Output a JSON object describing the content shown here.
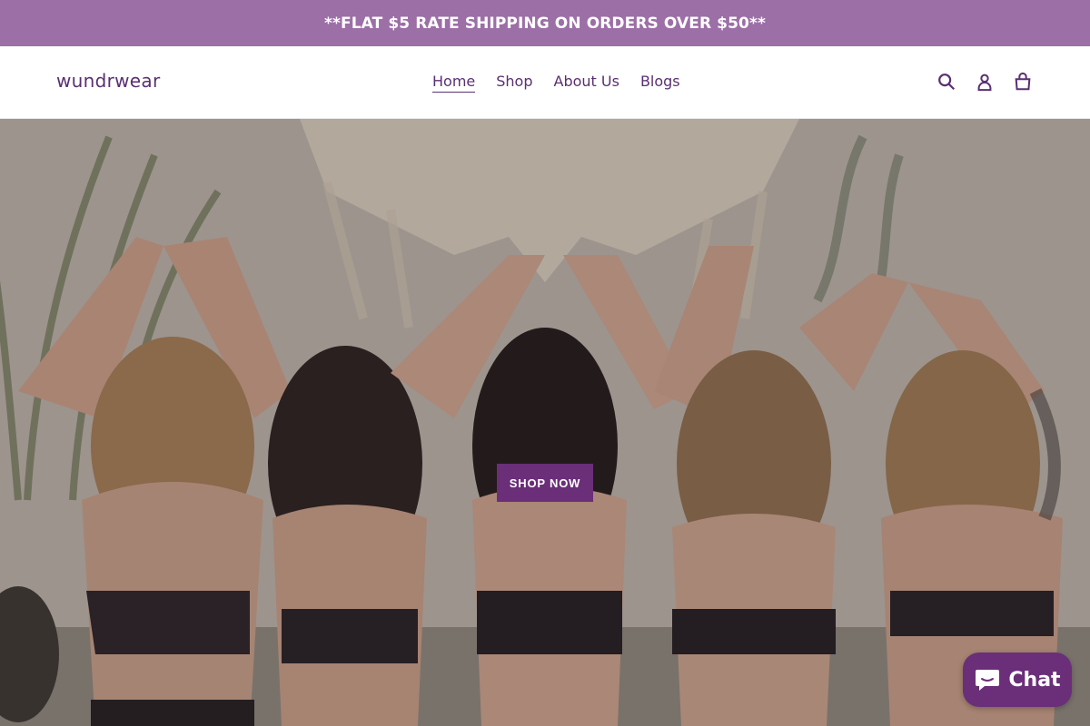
{
  "announcement": {
    "text": "**FLAT $5 RATE SHIPPING ON ORDERS OVER $50**"
  },
  "header": {
    "logo": "wundrwear",
    "nav": [
      {
        "label": "Home",
        "active": true
      },
      {
        "label": "Shop",
        "active": false
      },
      {
        "label": "About Us",
        "active": false
      },
      {
        "label": "Blogs",
        "active": false
      }
    ],
    "icons": [
      "search-icon",
      "account-icon",
      "cart-icon"
    ]
  },
  "hero": {
    "cta_label": "SHOP NOW"
  },
  "chat": {
    "label": "Chat",
    "icon": "chat-bubble-icon"
  },
  "colors": {
    "announcement_bg": "#9c6fa7",
    "brand_purple": "#5a2f73",
    "cta_bg": "#6a2f78"
  }
}
